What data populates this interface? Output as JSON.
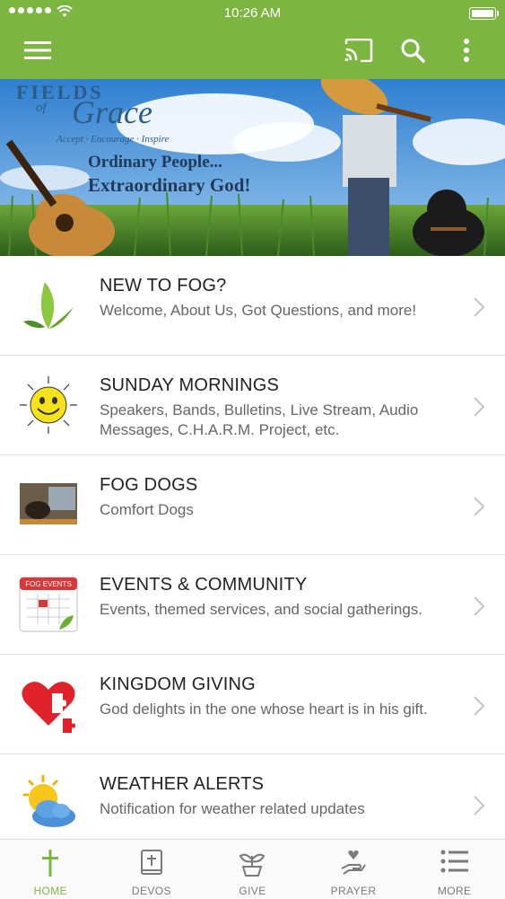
{
  "status_bar": {
    "time": "10:26 AM"
  },
  "colors": {
    "accent": "#7db542",
    "text": "#222222",
    "subtext": "#666666"
  },
  "toolbar": {
    "menu_icon": "hamburger-menu-icon",
    "cast_icon": "cast-icon",
    "search_icon": "search-icon",
    "more_icon": "more-vertical-icon"
  },
  "banner": {
    "logo_top": "FIELDS",
    "logo_of": "of",
    "logo_grace": "Grace",
    "tagline": "Accept · Encourage · Inspire",
    "line1": "Ordinary People...",
    "line2": "Extraordinary God!"
  },
  "items": [
    {
      "title": "NEW TO FOG?",
      "subtitle": "Welcome, About Us, Got Questions, and more!",
      "icon": "leaf-icon"
    },
    {
      "title": "SUNDAY MORNINGS",
      "subtitle": "Speakers, Bands, Bulletins, Live Stream, Audio Messages, C.H.A.R.M. Project, etc.",
      "icon": "sun-smiley-icon"
    },
    {
      "title": "FOG DOGS",
      "subtitle": "Comfort Dogs",
      "icon": "dog-photo-icon"
    },
    {
      "title": "EVENTS & COMMUNITY",
      "subtitle": "Events, themed services, and social gatherings.",
      "icon": "calendar-icon",
      "icon_label": "FOG EVENTS"
    },
    {
      "title": "KINGDOM GIVING",
      "subtitle": "God delights in the one whose heart is in his gift.",
      "icon": "heart-puzzle-icon"
    },
    {
      "title": "WEATHER ALERTS",
      "subtitle": "Notification for weather related updates",
      "icon": "sun-cloud-icon"
    }
  ],
  "tabs": [
    {
      "label": "HOME",
      "icon": "cross-icon",
      "active": true
    },
    {
      "label": "DEVOS",
      "icon": "bible-icon",
      "active": false
    },
    {
      "label": "GIVE",
      "icon": "plant-icon",
      "active": false
    },
    {
      "label": "PRAYER",
      "icon": "praying-hands-icon",
      "active": false
    },
    {
      "label": "MORE",
      "icon": "list-icon",
      "active": false
    }
  ]
}
